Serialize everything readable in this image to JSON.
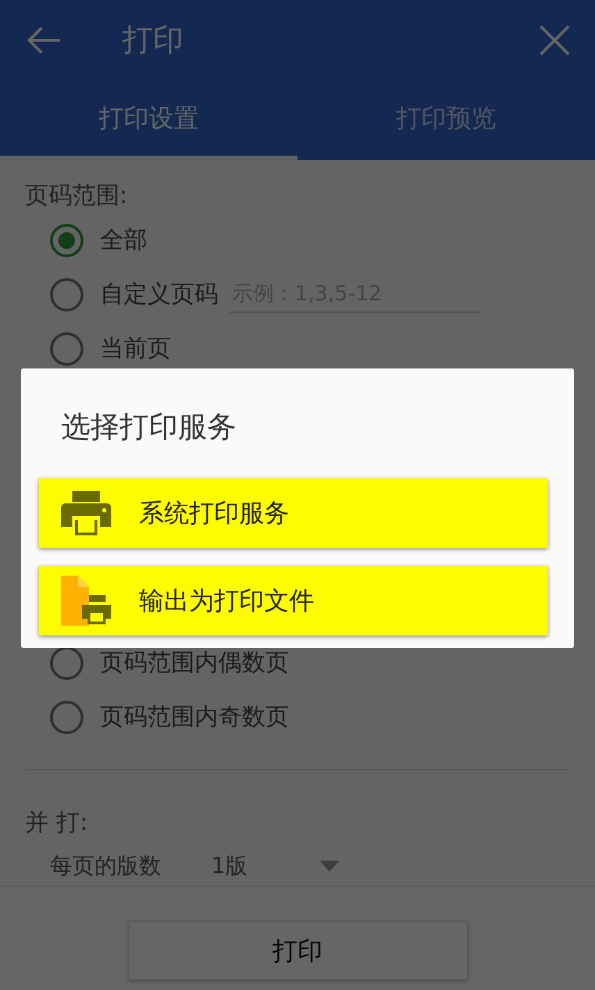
{
  "header": {
    "title": "打印"
  },
  "tabs": [
    {
      "label": "打印设置",
      "selected": true
    },
    {
      "label": "打印预览",
      "selected": false
    }
  ],
  "page_range": {
    "label": "页码范围:",
    "options": [
      {
        "label": "全部",
        "selected": true
      },
      {
        "label": "自定义页码",
        "selected": false,
        "placeholder": "示例：1,3,5-12"
      },
      {
        "label": "当前页",
        "selected": false
      },
      {
        "label": "页码范围内偶数页",
        "selected": false
      },
      {
        "label": "页码范围内奇数页",
        "selected": false
      }
    ]
  },
  "imposition": {
    "label": "并 打:",
    "setting_label": "每页的版数",
    "value": "1版"
  },
  "print_button": {
    "label": "打印"
  },
  "dialog": {
    "title": "选择打印服务",
    "items": [
      {
        "label": "系统打印服务",
        "kind": "printer"
      },
      {
        "label": "输出为打印文件",
        "kind": "file"
      }
    ]
  }
}
